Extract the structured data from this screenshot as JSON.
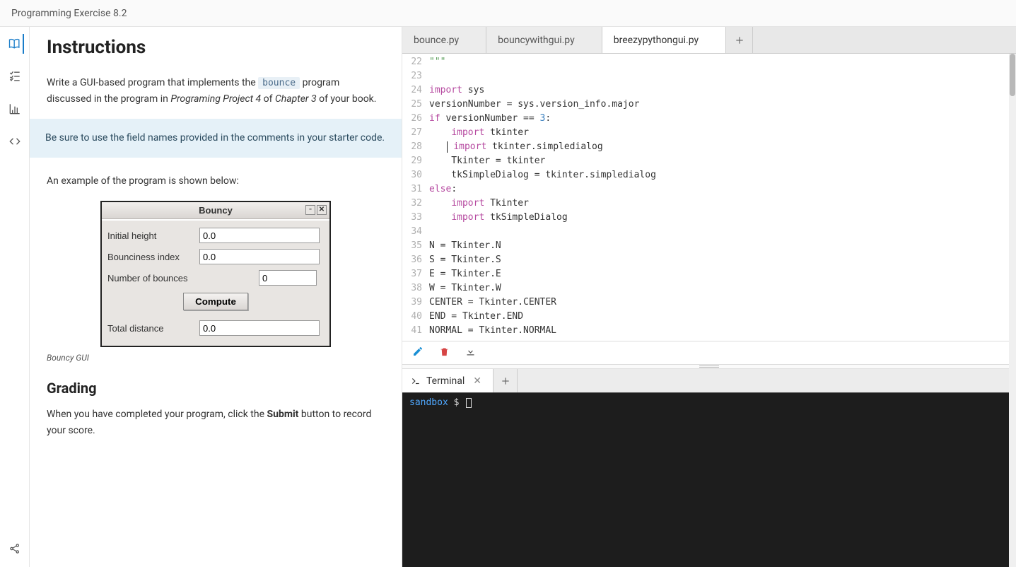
{
  "header": {
    "title": "Programming Exercise 8.2"
  },
  "rail": {
    "icons": [
      "book",
      "tasks",
      "chart",
      "code",
      "share"
    ]
  },
  "instructions": {
    "heading": "Instructions",
    "p1_a": "Write a GUI-based program that implements the ",
    "p1_code": "bounce",
    "p1_b": " program discussed in the program in ",
    "p1_em1": "Programing Project 4",
    "p1_c": " of ",
    "p1_em2": "Chapter 3",
    "p1_d": " of your book.",
    "note": "Be sure to use the field names provided in the comments in your starter code.",
    "p2": "An example of the program is shown below:",
    "gui": {
      "title": "Bouncy",
      "rows": {
        "r1_label": "Initial height",
        "r1_val": "0.0",
        "r2_label": "Bounciness index",
        "r2_val": "0.0",
        "r3_label": "Number of bounces",
        "r3_val": "0",
        "btn": "Compute",
        "r4_label": "Total distance",
        "r4_val": "0.0"
      }
    },
    "caption": "Bouncy GUI",
    "h2": "Grading",
    "p3_a": "When you have completed your program, click the ",
    "p3_b": "Submit",
    "p3_c": " button to record your score."
  },
  "editor": {
    "tabs": [
      {
        "label": "bounce.py",
        "active": false
      },
      {
        "label": "bouncywithgui.py",
        "active": false
      },
      {
        "label": "breezypythongui.py",
        "active": true
      }
    ],
    "lines": [
      {
        "n": 22,
        "html": "<span class='tok-str'>\"\"\"</span>"
      },
      {
        "n": 23,
        "html": ""
      },
      {
        "n": 24,
        "html": "<span class='tok-kw'>import</span> sys"
      },
      {
        "n": 25,
        "html": "versionNumber = sys.version_info.major"
      },
      {
        "n": 26,
        "html": "<span class='tok-kw'>if</span> versionNumber == <span class='tok-num'>3</span>:"
      },
      {
        "n": 27,
        "html": "    <span class='tok-kw'>import</span> tkinter"
      },
      {
        "n": 28,
        "html": "   <span class='cursor-mark'></span> <span class='tok-kw'>import</span> tkinter.simpledialog"
      },
      {
        "n": 29,
        "html": "    Tkinter = tkinter"
      },
      {
        "n": 30,
        "html": "    tkSimpleDialog = tkinter.simpledialog"
      },
      {
        "n": 31,
        "html": "<span class='tok-kw'>else</span>:"
      },
      {
        "n": 32,
        "html": "    <span class='tok-kw'>import</span> Tkinter"
      },
      {
        "n": 33,
        "html": "    <span class='tok-kw'>import</span> tkSimpleDialog"
      },
      {
        "n": 34,
        "html": ""
      },
      {
        "n": 35,
        "html": "N = Tkinter.N"
      },
      {
        "n": 36,
        "html": "S = Tkinter.S"
      },
      {
        "n": 37,
        "html": "E = Tkinter.E"
      },
      {
        "n": 38,
        "html": "W = Tkinter.W"
      },
      {
        "n": 39,
        "html": "CENTER = Tkinter.CENTER"
      },
      {
        "n": 40,
        "html": "END = Tkinter.END"
      },
      {
        "n": 41,
        "html": "NORMAL = Tkinter.NORMAL"
      }
    ]
  },
  "toolbar": {
    "edit": "edit",
    "trash": "trash",
    "download": "download"
  },
  "terminal": {
    "tab_label": "Terminal",
    "prompt_host": "sandbox",
    "prompt_sym": "$"
  }
}
